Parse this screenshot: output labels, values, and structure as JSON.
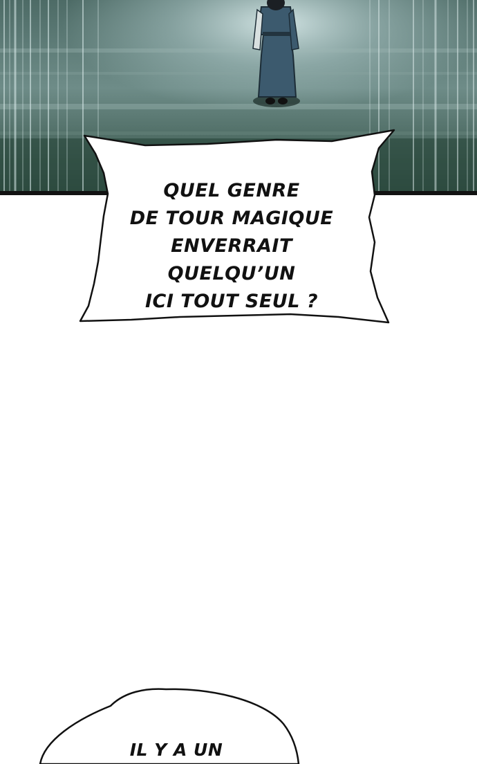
{
  "page": {
    "background": "#ffffff"
  },
  "panel": {
    "scene": "misty-field-with-figure",
    "colors": {
      "sky_dark": "#2f4944",
      "sky_light": "#a9c3c3",
      "ground": "#2c4a3e",
      "figure_robe": "#3c5a6e",
      "border": "#121212"
    }
  },
  "bubbles": [
    {
      "lines": [
        "QUEL GENRE",
        "DE TOUR MAGIQUE",
        "ENVERRAIT QUELQU’UN",
        "ICI TOUT SEUL ?"
      ]
    },
    {
      "lines": [
        "IL Y A UN"
      ]
    }
  ]
}
